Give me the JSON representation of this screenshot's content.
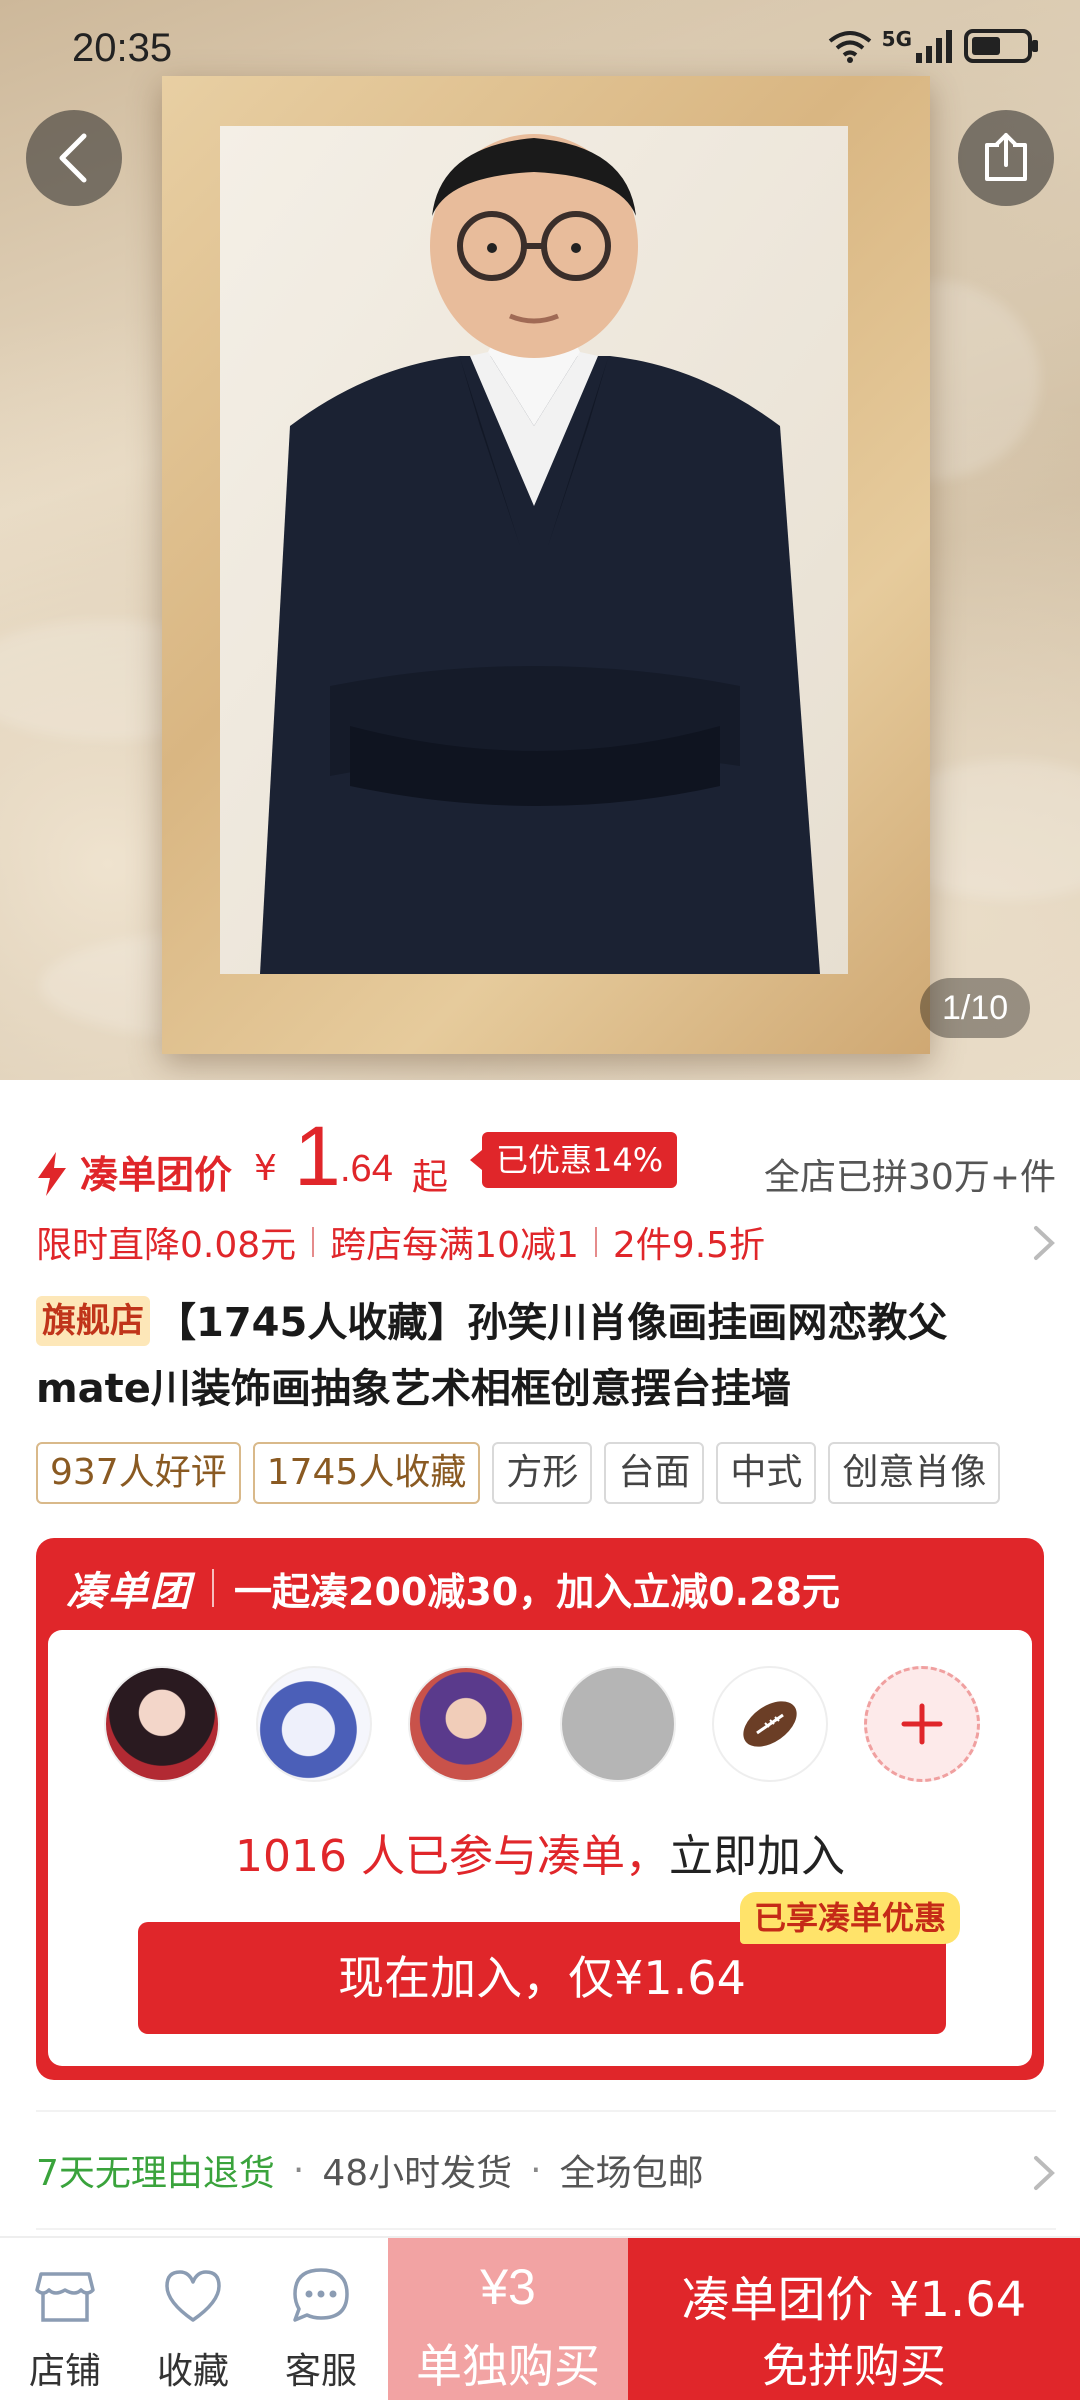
{
  "status_bar": {
    "time": "20:35",
    "network": "5G"
  },
  "gallery": {
    "counter": "1/10"
  },
  "price": {
    "label": "凑单团价",
    "currency": "¥",
    "integer": "1",
    "decimal": ".64",
    "suffix": "起",
    "discount_badge": "已优惠14%",
    "sold": "全店已拼30万+件"
  },
  "promotions": [
    "限时直降0.08元",
    "跨店每满10减1",
    "2件9.5折"
  ],
  "title": {
    "store_tag": "旗舰店",
    "text": "【1745人收藏】孙笑川肖像画挂画网恋教父mate川装饰画抽象艺术相框创意摆台挂墙"
  },
  "tags": [
    {
      "label": "937人好评",
      "style": "gold"
    },
    {
      "label": "1745人收藏",
      "style": "gold"
    },
    {
      "label": "方形",
      "style": "plain"
    },
    {
      "label": "台面",
      "style": "plain"
    },
    {
      "label": "中式",
      "style": "plain"
    },
    {
      "label": "创意肖像",
      "style": "plain"
    }
  ],
  "group_buy": {
    "logo": "凑单团",
    "headline": "一起凑200减30，加入立减0.28元",
    "participants_count": "1016 人已参与凑单，",
    "join_prompt": "立即加入",
    "join_button": "现在加入，仅¥1.64",
    "join_badge": "已享凑单优惠"
  },
  "service": {
    "return_policy": "7天无理由退货",
    "shipping": "48小时发货",
    "free_shipping": "全场包邮",
    "separator": "·"
  },
  "bottom_bar": {
    "store": "店铺",
    "favorite": "收藏",
    "service": "客服",
    "single_price": "¥3",
    "single_label": "单独购买",
    "group_price": "凑单团价 ¥1.64",
    "group_label": "免拼购买"
  },
  "colors": {
    "accent": "#e0262a",
    "green": "#3aa33c",
    "badge_yellow": "#ffe36a"
  }
}
